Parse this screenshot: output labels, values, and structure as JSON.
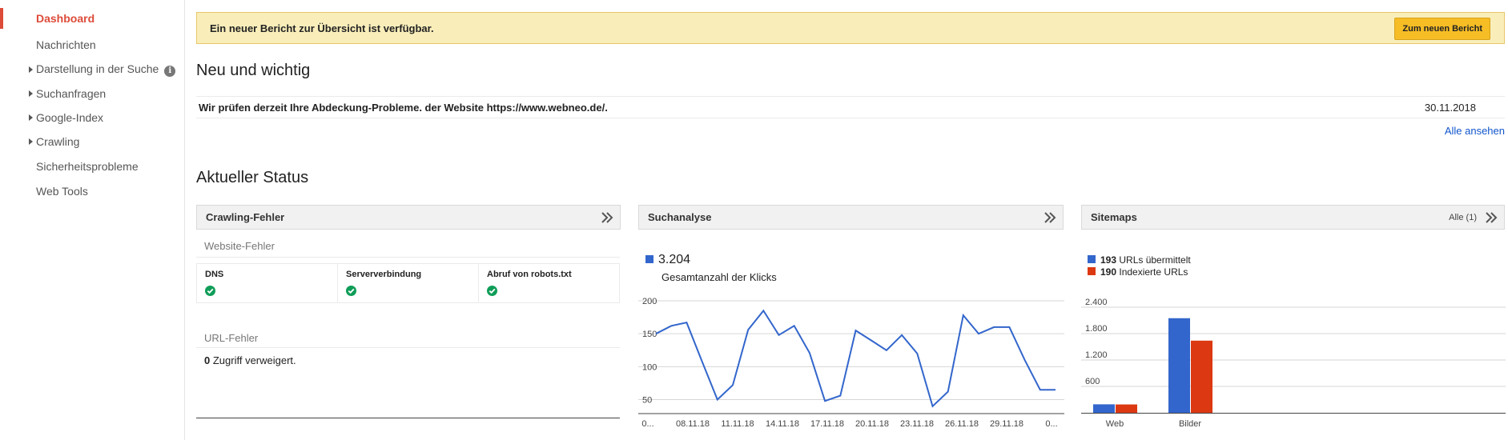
{
  "sidebar": {
    "items": [
      {
        "label": "Dashboard",
        "active": true,
        "expandable": false
      },
      {
        "label": "Nachrichten",
        "active": false,
        "expandable": false
      },
      {
        "label": "Darstellung in der Suche",
        "active": false,
        "expandable": true,
        "info": "i"
      },
      {
        "label": "Suchanfragen",
        "active": false,
        "expandable": true
      },
      {
        "label": "Google-Index",
        "active": false,
        "expandable": true
      },
      {
        "label": "Crawling",
        "active": false,
        "expandable": true
      },
      {
        "label": "Sicherheitsprobleme",
        "active": false,
        "expandable": false
      },
      {
        "label": "Web Tools",
        "active": false,
        "expandable": false
      }
    ]
  },
  "banner": {
    "text": "Ein neuer Bericht zur Übersicht ist verfügbar.",
    "button": "Zum neuen Bericht"
  },
  "news": {
    "title": "Neu und wichtig",
    "items": [
      {
        "text": "Wir prüfen derzeit Ihre Abdeckung-Probleme. der Website https://www.webneo.de/.",
        "date": "30.11.2018"
      }
    ],
    "see_all": "Alle ansehen"
  },
  "status": {
    "title": "Aktueller Status",
    "crawl_errors": {
      "title": "Crawling-Fehler",
      "site_errors_label": "Website-Fehler",
      "checks": [
        {
          "label": "DNS",
          "status": "ok"
        },
        {
          "label": "Serververbindung",
          "status": "ok"
        },
        {
          "label": "Abruf von robots.txt",
          "status": "ok"
        }
      ],
      "url_errors_label": "URL-Fehler",
      "url_errors_count": "0",
      "url_errors_text": " Zugriff verweigert."
    },
    "search_analytics": {
      "title": "Suchanalyse",
      "total": "3.204",
      "total_label": "Gesamtanzahl der Klicks"
    },
    "sitemaps": {
      "title": "Sitemaps",
      "all_link": "Alle (1)",
      "submitted_count": "193",
      "submitted_label": " URLs übermittelt",
      "indexed_count": "190",
      "indexed_label": " Indexierte URLs"
    }
  },
  "colors": {
    "active": "#dd4b39",
    "link": "#1155cc",
    "line": "#3366cc",
    "bar_submitted": "#3366cc",
    "bar_indexed": "#dc3912",
    "check": "#0f9d58",
    "banner_bg": "#f9eeba",
    "button": "#f6bd25"
  },
  "icons": {
    "expand": "double-chevron-right-icon",
    "check": "check-circle-icon",
    "info": "info-icon",
    "caret": "caret-right-icon"
  },
  "chart_data": [
    {
      "type": "line",
      "title": "",
      "x_tick_labels": [
        "0...",
        "08.11.18",
        "11.11.18",
        "14.11.18",
        "17.11.18",
        "20.11.18",
        "23.11.18",
        "26.11.18",
        "29.11.18",
        "0..."
      ],
      "y_tick_labels": [
        "200",
        "150",
        "100",
        "50"
      ],
      "ylim": [
        30,
        200
      ],
      "y_ticks": [
        200,
        150,
        100,
        50
      ],
      "grid": true,
      "series": [
        {
          "values": [
            150,
            162,
            167,
            108,
            50,
            72,
            156,
            185,
            148,
            162,
            121,
            48,
            56,
            155,
            140,
            125,
            148,
            120,
            40,
            62,
            178,
            150,
            160,
            160,
            110,
            65,
            65
          ]
        }
      ]
    },
    {
      "type": "bar",
      "categories": [
        "Web",
        "Bilder"
      ],
      "y_tick_labels": [
        "2.400",
        "1.800",
        "1.200",
        "600"
      ],
      "ylim": [
        0,
        2400
      ],
      "y_ticks": [
        2400,
        1800,
        1200,
        600
      ],
      "grid": true,
      "series": [
        {
          "name": "URLs übermittelt",
          "values": [
            193,
            2150
          ]
        },
        {
          "name": "Indexierte URLs",
          "values": [
            190,
            1640
          ]
        }
      ]
    }
  ]
}
